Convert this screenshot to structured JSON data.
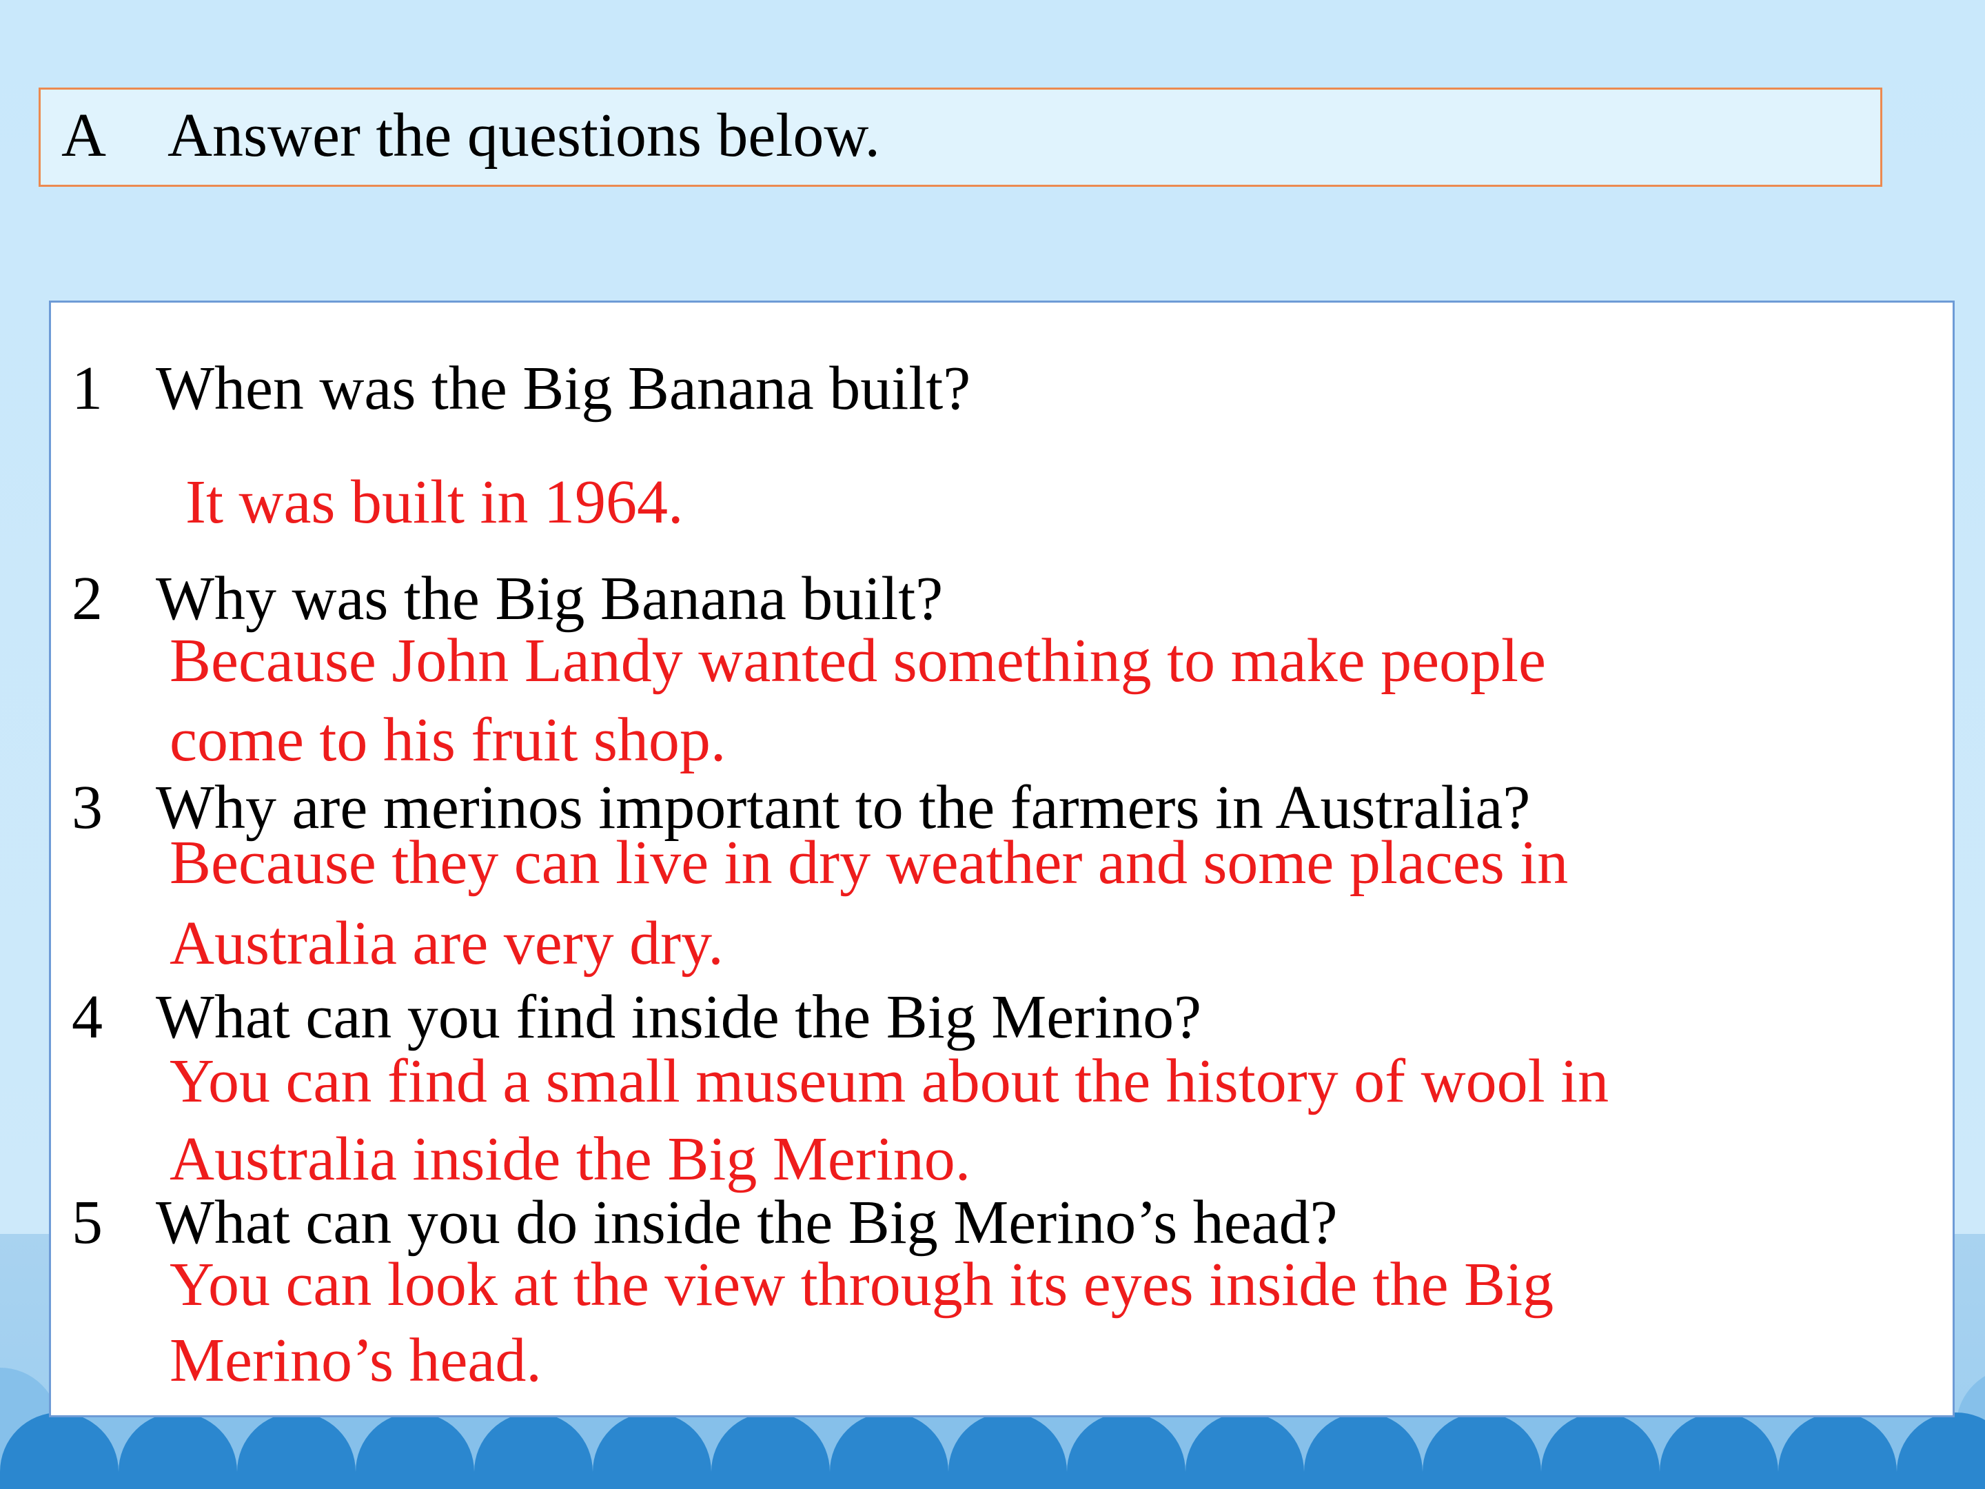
{
  "header": {
    "letter": "A",
    "instruction": "Answer the questions below."
  },
  "questions": [
    {
      "number": "1",
      "question": "When was the Big Banana built?",
      "answer": [
        "It was built in 1964."
      ]
    },
    {
      "number": "2",
      "question": "Why was the Big Banana built?",
      "answer": [
        "Because John Landy wanted something to make people",
        "come to his fruit shop."
      ]
    },
    {
      "number": "3",
      "question": "Why are merinos important to the farmers in Australia?",
      "answer": [
        "Because they can live in dry weather and some places in",
        "Australia are very dry."
      ]
    },
    {
      "number": "4",
      "question": "What can you find inside the Big Merino?",
      "answer": [
        "You can find a small museum about the history of wool in",
        "Australia inside the Big Merino."
      ]
    },
    {
      "number": "5",
      "question": "What can you do inside the Big Merino’s head?",
      "answer": [
        "You can look at the view through its eyes inside the Big",
        "Merino’s head."
      ]
    }
  ],
  "colors": {
    "background": "#c9e8fb",
    "header_fill": "#e0f3fd",
    "header_border": "#ec8a50",
    "panel_border": "#6e9bd6",
    "answer_text": "#ee1c1c",
    "wave": "#2b87cf"
  }
}
